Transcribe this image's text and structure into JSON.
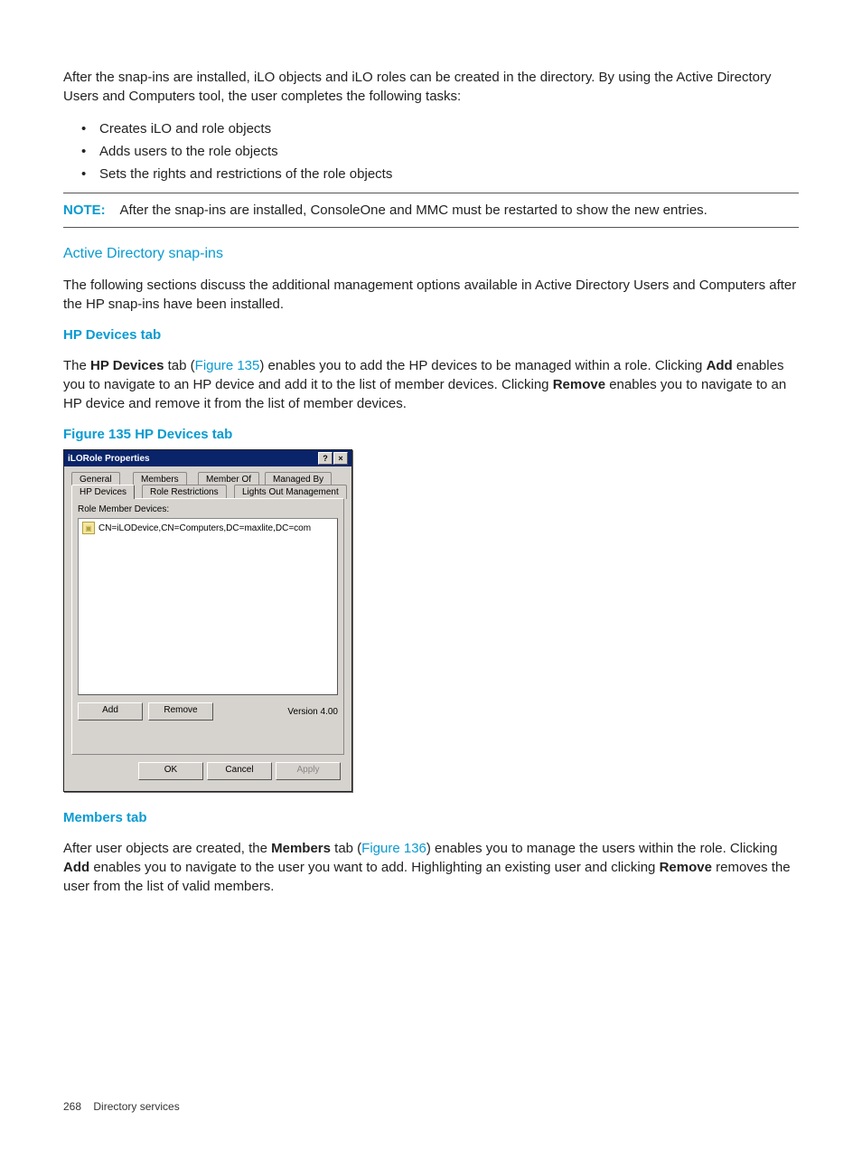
{
  "intro": {
    "p1": "After the snap-ins are installed, iLO objects and iLO roles can be created in the directory. By using the Active Directory Users and Computers tool, the user completes the following tasks:"
  },
  "bullets": {
    "b1": "Creates iLO and role objects",
    "b2": "Adds users to the role objects",
    "b3": "Sets the rights and restrictions of the role objects"
  },
  "note": {
    "label": "NOTE:",
    "text": "After the snap-ins are installed, ConsoleOne and MMC must be restarted to show the new entries."
  },
  "section_ad": {
    "title": "Active Directory snap-ins",
    "p": "The following sections discuss the additional management options available in Active Directory Users and Computers after the HP snap-ins have been installed."
  },
  "section_hp": {
    "title": "HP Devices tab",
    "p_pre": "The ",
    "p_bold1": "HP Devices",
    "p_mid1": " tab (",
    "p_link": "Figure 135",
    "p_mid2": ") enables you to add the HP devices to be managed within a role. Clicking ",
    "p_bold2": "Add",
    "p_mid3": " enables you to navigate to an HP device and add it to the list of member devices. Clicking ",
    "p_bold3": "Remove",
    "p_mid4": " enables you to navigate to an HP device and remove it from the list of member devices."
  },
  "figure": {
    "caption": "Figure 135 HP Devices tab"
  },
  "dialog": {
    "title": "iLORole Properties",
    "help": "?",
    "close": "×",
    "tabs": {
      "general": "General",
      "members": "Members",
      "member_of": "Member Of",
      "managed_by": "Managed By",
      "hp_devices": "HP Devices",
      "role_restrictions": "Role Restrictions",
      "lights_out": "Lights Out Management"
    },
    "group_label": "Role Member Devices:",
    "list_item1": "CN=iLODevice,CN=Computers,DC=maxlite,DC=com",
    "add": "Add",
    "remove": "Remove",
    "version": "Version  4.00",
    "ok": "OK",
    "cancel": "Cancel",
    "apply": "Apply"
  },
  "section_members": {
    "title": "Members tab",
    "p_pre": "After user objects are created, the ",
    "p_bold1": "Members",
    "p_mid1": " tab (",
    "p_link": "Figure 136",
    "p_mid2": ") enables you to manage the users within the role. Clicking ",
    "p_bold2": "Add",
    "p_mid3": " enables you to navigate to the user you want to add. Highlighting an existing user and clicking ",
    "p_bold3": "Remove",
    "p_mid4": " removes the user from the list of valid members."
  },
  "footer": {
    "page_num": "268",
    "section": "Directory services"
  }
}
